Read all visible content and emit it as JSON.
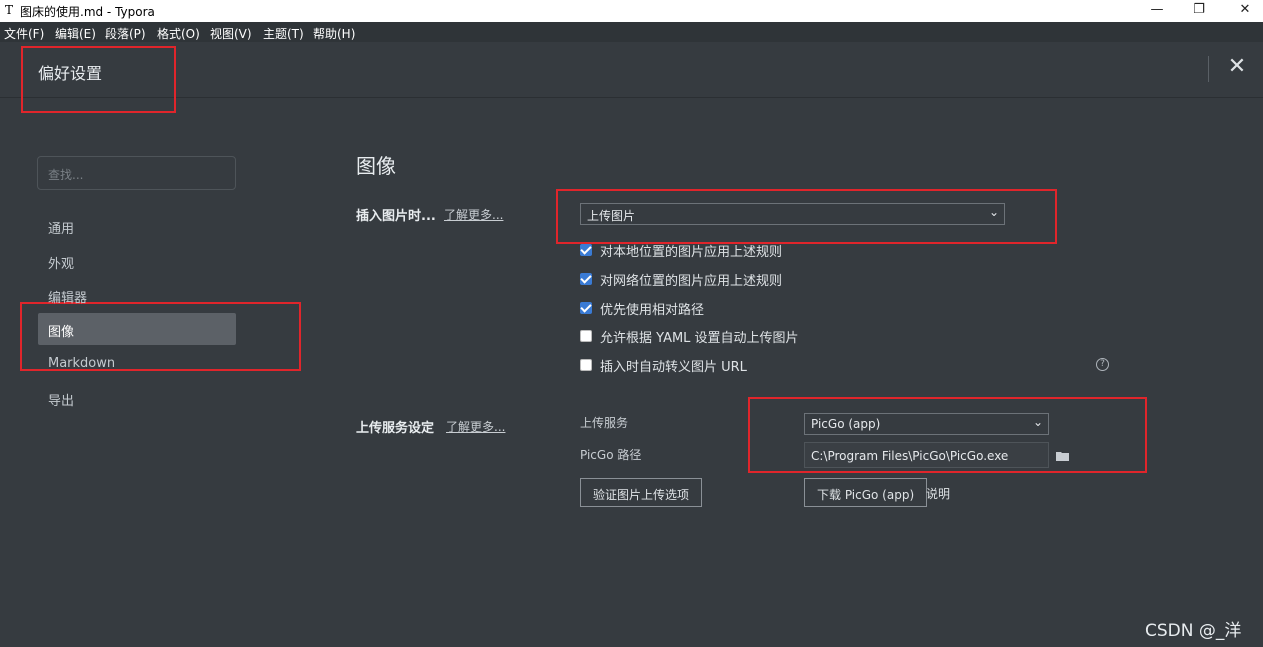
{
  "window": {
    "app_icon": "T",
    "title": "图床的使用.md - Typora",
    "controls": {
      "minimize": "—",
      "maximize": "❐",
      "close": "✕"
    }
  },
  "menubar": {
    "items": [
      "文件(F)",
      "编辑(E)",
      "段落(P)",
      "格式(O)",
      "视图(V)",
      "主题(T)",
      "帮助(H)"
    ]
  },
  "header": {
    "title": "偏好设置",
    "close_icon": "close-icon",
    "close_glyph": "✕"
  },
  "sidebar": {
    "search_placeholder": "查找...",
    "items": [
      {
        "label": "通用",
        "active": false
      },
      {
        "label": "外观",
        "active": false
      },
      {
        "label": "编辑器",
        "active": false
      },
      {
        "label": "图像",
        "active": true
      },
      {
        "label": "Markdown",
        "active": false
      },
      {
        "label": "导出",
        "active": false
      }
    ]
  },
  "main": {
    "section_title": "图像",
    "insert": {
      "label": "插入图片时...",
      "learn_more": "了解更多...",
      "select_value": "上传图片",
      "checkboxes": [
        {
          "label": "对本地位置的图片应用上述规则",
          "checked": true
        },
        {
          "label": "对网络位置的图片应用上述规则",
          "checked": true
        },
        {
          "label": "优先使用相对路径",
          "checked": true
        },
        {
          "label": "允许根据 YAML 设置自动上传图片",
          "checked": false
        },
        {
          "label": "插入时自动转义图片 URL",
          "checked": false
        }
      ],
      "help_glyph": "?"
    },
    "upload": {
      "label": "上传服务设定",
      "learn_more": "了解更多...",
      "service_label": "上传服务",
      "service_value": "PicGo (app)",
      "path_label": "PicGo 路径",
      "path_value": "C:\\Program Files\\PicGo\\PicGo.exe",
      "verify_button": "验证图片上传选项",
      "download_button": "下载 PicGo (app)",
      "explain_link": "说明"
    }
  },
  "watermark": "CSDN @_洋",
  "colors": {
    "accent_checkbox": "#3a7bd5",
    "highlight_box": "#e0252b",
    "background": "#363b40"
  }
}
